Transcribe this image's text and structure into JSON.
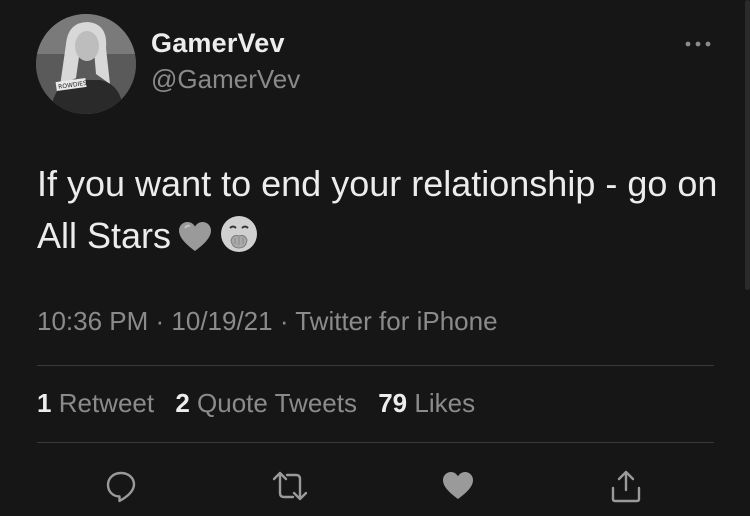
{
  "user": {
    "display_name": "GamerVev",
    "handle": "@GamerVev",
    "avatar_badge_text": "ROWDIES"
  },
  "tweet": {
    "text": "If you want to end your relationship - go on All Stars",
    "emojis": [
      "grey-heart",
      "face-with-hand-over-mouth"
    ],
    "meta": "10:36 PM · 10/19/21 · Twitter for iPhone"
  },
  "stats": [
    {
      "count": "1",
      "label": "Retweet"
    },
    {
      "count": "2",
      "label": "Quote Tweets"
    },
    {
      "count": "79",
      "label": "Likes"
    }
  ],
  "actions": [
    "reply-icon",
    "retweet-icon",
    "like-icon",
    "share-icon"
  ],
  "colors": {
    "background": "#161616",
    "text": "#ececec",
    "muted": "#8b8b8b",
    "divider": "#3a3a3a"
  }
}
